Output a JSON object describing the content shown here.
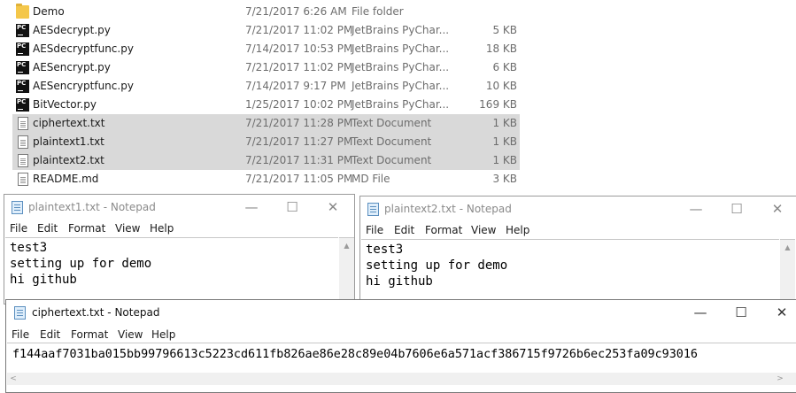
{
  "explorer": {
    "files": [
      {
        "name": "Demo",
        "date": "7/21/2017 6:26 AM",
        "type": "File folder",
        "size": "",
        "icon": "folder-icon",
        "selected": false
      },
      {
        "name": "AESdecrypt.py",
        "date": "7/21/2017 11:02 PM",
        "type": "JetBrains PyChar...",
        "size": "5 KB",
        "icon": "pycharm-file-icon",
        "selected": false
      },
      {
        "name": "AESdecryptfunc.py",
        "date": "7/14/2017 10:53 PM",
        "type": "JetBrains PyChar...",
        "size": "18 KB",
        "icon": "pycharm-file-icon",
        "selected": false
      },
      {
        "name": "AESencrypt.py",
        "date": "7/21/2017 11:02 PM",
        "type": "JetBrains PyChar...",
        "size": "6 KB",
        "icon": "pycharm-file-icon",
        "selected": false
      },
      {
        "name": "AESencryptfunc.py",
        "date": "7/14/2017 9:17 PM",
        "type": "JetBrains PyChar...",
        "size": "10 KB",
        "icon": "pycharm-file-icon",
        "selected": false
      },
      {
        "name": "BitVector.py",
        "date": "1/25/2017 10:02 PM",
        "type": "JetBrains PyChar...",
        "size": "169 KB",
        "icon": "pycharm-file-icon",
        "selected": false
      },
      {
        "name": "ciphertext.txt",
        "date": "7/21/2017 11:28 PM",
        "type": "Text Document",
        "size": "1 KB",
        "icon": "text-file-icon",
        "selected": true
      },
      {
        "name": "plaintext1.txt",
        "date": "7/21/2017 11:27 PM",
        "type": "Text Document",
        "size": "1 KB",
        "icon": "text-file-icon",
        "selected": true
      },
      {
        "name": "plaintext2.txt",
        "date": "7/21/2017 11:31 PM",
        "type": "Text Document",
        "size": "1 KB",
        "icon": "text-file-icon",
        "selected": true
      },
      {
        "name": "README.md",
        "date": "7/21/2017 11:05 PM",
        "type": "MD File",
        "size": "3 KB",
        "icon": "text-file-icon",
        "selected": false
      }
    ]
  },
  "menu_labels": [
    "File",
    "Edit",
    "Format",
    "View",
    "Help"
  ],
  "window_buttons": {
    "minimize": "—",
    "maximize": "☐",
    "close": "✕"
  },
  "notepad1": {
    "title": "plaintext1.txt - Notepad",
    "content": "test3\nsetting up for demo\nhi github"
  },
  "notepad2": {
    "title": "plaintext2.txt - Notepad",
    "content": "test3\nsetting up for demo\nhi github"
  },
  "notepad3": {
    "title": "ciphertext.txt - Notepad",
    "content": "f144aaf7031ba015bb99796613c5223cd611fb826ae86e28c89e04b7606e6a571acf386715f9726b6ec253fa09c93016"
  },
  "colors": {
    "selection": "#d9d9d9",
    "folder": "#f4c74a",
    "secondary_text": "#6d6d6d"
  }
}
